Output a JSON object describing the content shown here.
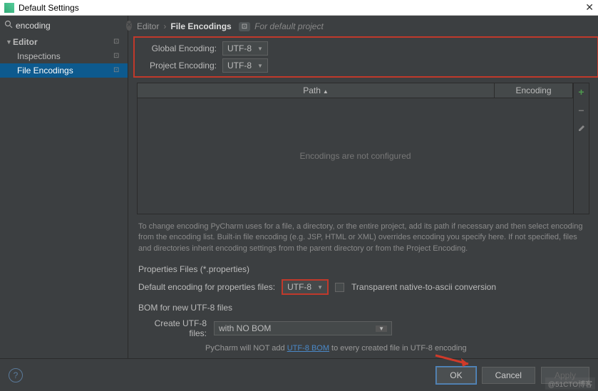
{
  "window": {
    "title": "Default Settings"
  },
  "search": {
    "value": "encoding",
    "placeholder": ""
  },
  "sidebar": {
    "items": [
      {
        "label": "Editor",
        "expanded": true
      },
      {
        "label": "Inspections"
      },
      {
        "label": "File Encodings"
      }
    ]
  },
  "breadcrumb": {
    "parent": "Editor",
    "current": "File Encodings",
    "scope": "For default project"
  },
  "encoding": {
    "global_label": "Global Encoding:",
    "global_value": "UTF-8",
    "project_label": "Project Encoding:",
    "project_value": "UTF-8"
  },
  "table": {
    "col_path": "Path",
    "col_encoding": "Encoding",
    "empty": "Encodings are not configured"
  },
  "help_text": "To change encoding PyCharm uses for a file, a directory, or the entire project, add its path if necessary and then select encoding from the encoding list. Built-in file encoding (e.g. JSP, HTML or XML) overrides encoding you specify here. If not specified, files and directories inherit encoding settings from the parent directory or from the Project Encoding.",
  "properties": {
    "section": "Properties Files (*.properties)",
    "label": "Default encoding for properties files:",
    "value": "UTF-8",
    "checkbox_label": "Transparent native-to-ascii conversion"
  },
  "bom": {
    "section": "BOM for new UTF-8 files",
    "label": "Create UTF-8 files:",
    "value": "with NO BOM",
    "note_pre": "PyCharm will NOT add ",
    "note_link": "UTF-8 BOM",
    "note_post": " to every created file in UTF-8 encoding"
  },
  "footer": {
    "ok": "OK",
    "cancel": "Cancel",
    "apply": "Apply"
  },
  "watermark": "@51CTO博客"
}
